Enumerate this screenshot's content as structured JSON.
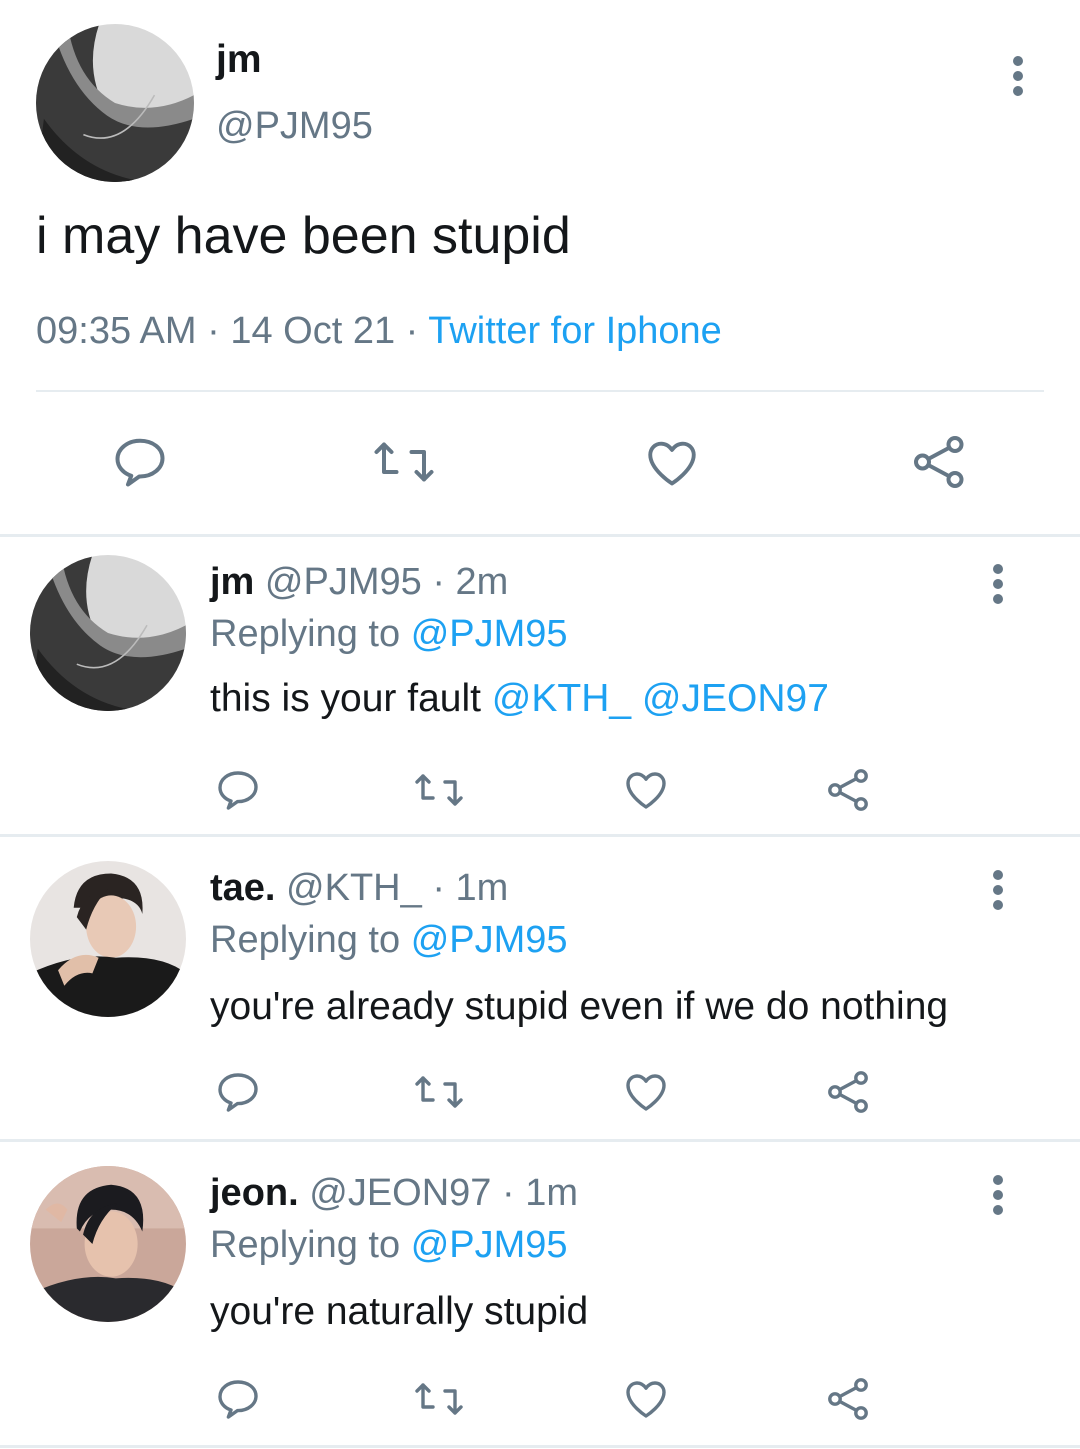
{
  "main_tweet": {
    "name": "jm",
    "handle": "@PJM95",
    "text": "i may have been stupid",
    "time": "09:35 AM",
    "date": "14 Oct 21",
    "source": "Twitter for Iphone",
    "dot": "·",
    "avatar": "avatar-photo-neck-necklace",
    "actions": [
      "reply-icon",
      "retweet-icon",
      "like-icon",
      "share-icon"
    ]
  },
  "replies": [
    {
      "name": "jm",
      "handle": "@PJM95",
      "time": "· 2m",
      "replying_prefix": "Replying to",
      "replying_handle": "@PJM95",
      "text": "this is your fault",
      "mention_1": "@KTH_",
      "mention_2": "@JEON97"
    },
    {
      "name": "tae.",
      "handle": "@KTH_",
      "time": "· 1m",
      "replying_prefix": "Replying to",
      "replying_handle": "@PJM95",
      "text": "you're already stupid even if we do nothing"
    },
    {
      "name": "jeon.",
      "handle": "@JEON97",
      "time": "· 1m",
      "replying_prefix": "Replying to",
      "replying_handle": "@PJM95",
      "text": "you're naturally stupid"
    }
  ],
  "colors": {
    "text": "#14171a",
    "secondary": "#657786",
    "link": "#1da1f2",
    "divider": "#e6ecf0"
  }
}
